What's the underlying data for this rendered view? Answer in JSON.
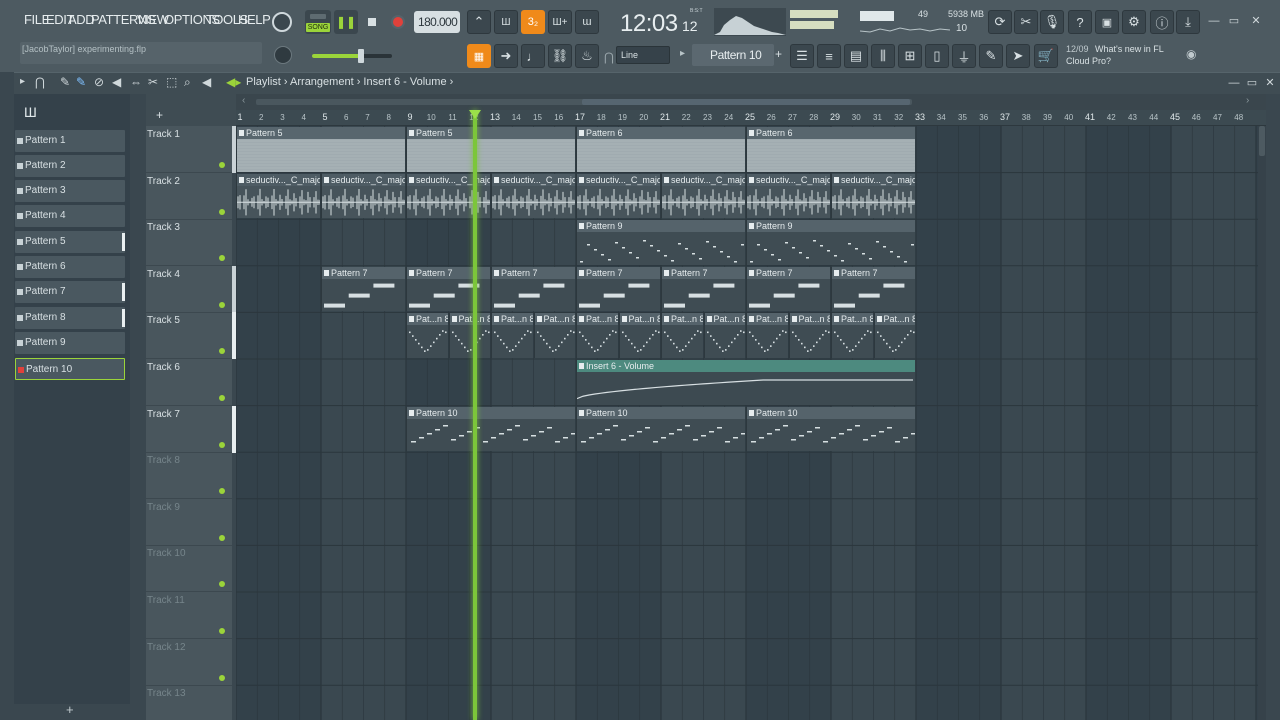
{
  "menu": [
    "FILE",
    "EDIT",
    "ADD",
    "PATTERNS",
    "VIEW",
    "OPTIONS",
    "TOOLS",
    "HELP"
  ],
  "project_hint": "[JacobTaylor] experimenting.flp",
  "transport": {
    "mode": "SONG",
    "tempo": "180.000",
    "time_main": "12:03",
    "time_sub": "12",
    "time_label": "B:S:T"
  },
  "monitor": {
    "cpu_value": "49",
    "ram": "5938 MB",
    "polyphony": "10"
  },
  "snap": "Line",
  "pattern_selector": "Pattern 10",
  "news": {
    "date": "12/09",
    "text_line1": "What's new in FL",
    "text_line2": "Cloud Pro?"
  },
  "breadcrumb": {
    "root": "Playlist",
    "part1": "Arrangement",
    "part2": "Insert 6 - Volume"
  },
  "picker_items": [
    "Pattern 1",
    "Pattern 2",
    "Pattern 3",
    "Pattern 4",
    "Pattern 5",
    "Pattern 6",
    "Pattern 7",
    "Pattern 8",
    "Pattern 9",
    "Pattern 10"
  ],
  "tracks": [
    "Track 1",
    "Track 2",
    "Track 3",
    "Track 4",
    "Track 5",
    "Track 6",
    "Track 7",
    "Track 8",
    "Track 9",
    "Track 10",
    "Track 11",
    "Track 12",
    "Track 13"
  ],
  "ruler_bars": [
    "1",
    "2",
    "3",
    "4",
    "5",
    "6",
    "7",
    "8",
    "9",
    "10",
    "11",
    "12",
    "13",
    "14",
    "15",
    "16",
    "17",
    "18",
    "19",
    "20",
    "21",
    "22",
    "23",
    "24",
    "25",
    "26",
    "27",
    "28",
    "29",
    "30",
    "31",
    "32",
    "33",
    "34",
    "35",
    "36",
    "37",
    "38",
    "39",
    "40",
    "41",
    "42",
    "43",
    "44",
    "45",
    "46",
    "47",
    "48"
  ],
  "clip_labels": {
    "p5": "Pattern 5",
    "p6": "Pattern 6",
    "audio": "seductiv..._C_major",
    "p9": "Pattern 9",
    "p7": "Pattern 7",
    "p8": "Pat...n 8",
    "auto": "Insert 6 - Volume",
    "p10": "Pattern 10"
  },
  "colors": {
    "accent_green": "#9bd43a",
    "playhead": "#7cc63a",
    "clip_header": "#55666f",
    "clip_light": "#9aa6ab",
    "auto_clip": "#4d8a7f"
  }
}
